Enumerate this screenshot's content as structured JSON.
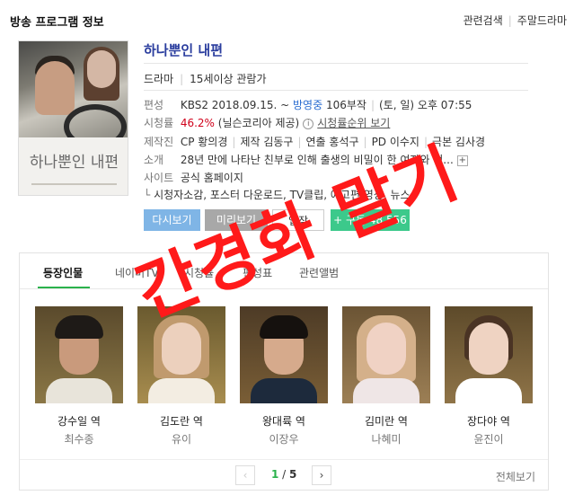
{
  "header": {
    "title": "방송 프로그램 정보",
    "links": [
      "관련검색",
      "주말드라마"
    ]
  },
  "poster": {
    "title_text": "하나뿐인 내편"
  },
  "program": {
    "name": "하나뿐인 내편",
    "genre": "드라마",
    "rating_age": "15세이상 관람가",
    "rows": {
      "schedule_label": "편성",
      "schedule_channel": "KBS2 2018.09.15. ~",
      "schedule_status": "방영중",
      "schedule_episodes": "106부작",
      "schedule_time": "(토, 일) 오후 07:55",
      "ratings_label": "시청률",
      "ratings_value": "46.2%",
      "ratings_source": "(닐슨코리아 제공)",
      "ratings_rank": "시청률순위 보기",
      "staff_label": "제작진",
      "staff_cp": "CP 황의경",
      "staff_producer": "제작 김동구",
      "staff_director": "연출 홍석구",
      "staff_pd": "PD 이수지",
      "staff_writer": "극본 김사경",
      "intro_label": "소개",
      "intro_text": "28년 만에 나타난 친부로 인해 출생의 비밀이 한 여자와 정...",
      "site_label": "사이트",
      "site_link": "공식 홈페이지",
      "extra_links": "시청자소감, 포스터 다운로드, TV클립, 예고편 영상, 뉴스"
    }
  },
  "buttons": {
    "rewatch": "다시보기",
    "preview": "미리보기",
    "enter": "입장",
    "subscribe": "+ 구독 48,556"
  },
  "watermark": "간경화 말기",
  "tabs": [
    "등장인물",
    "네이버TV",
    "시청률",
    "편성표",
    "관련앨범"
  ],
  "cast": [
    {
      "role": "강수일 역",
      "actor": "최수종"
    },
    {
      "role": "김도란 역",
      "actor": "유이"
    },
    {
      "role": "왕대륙 역",
      "actor": "이장우"
    },
    {
      "role": "김미란 역",
      "actor": "나혜미"
    },
    {
      "role": "장다야 역",
      "actor": "윤진이"
    }
  ],
  "pager": {
    "current": "1",
    "separator": " / ",
    "total": "5",
    "view_all": "전체보기"
  },
  "colors": {
    "accent_green": "#2bb24c",
    "title_blue": "#2a3d9e",
    "rating_red": "#d0021b",
    "watermark_red": "#ff1a1a"
  }
}
